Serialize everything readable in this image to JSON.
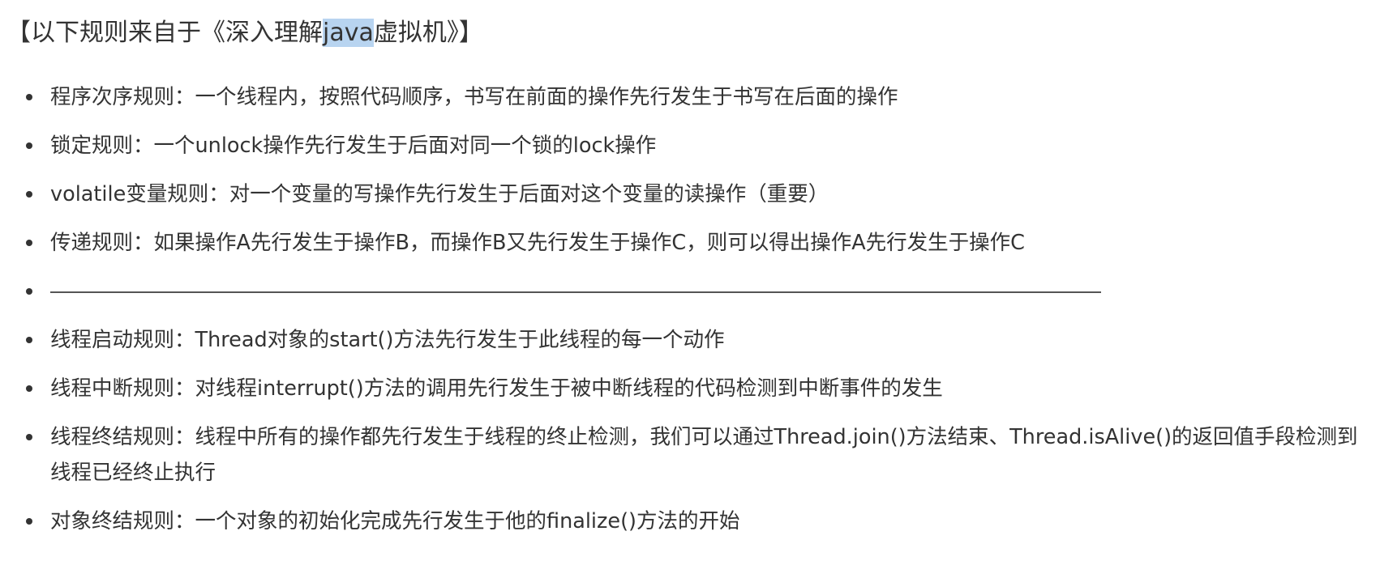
{
  "heading": {
    "prefix": "【以下规则来自于《深入理解",
    "highlight": "java",
    "suffix": "虚拟机》】"
  },
  "rules": [
    "程序次序规则：一个线程内，按照代码顺序，书写在前面的操作先行发生于书写在后面的操作",
    "锁定规则：一个unlock操作先行发生于后面对同一个锁的lock操作",
    "volatile变量规则：对一个变量的写操作先行发生于后面对这个变量的读操作（重要）",
    "传递规则：如果操作A先行发生于操作B，而操作B又先行发生于操作C，则可以得出操作A先行发生于操作C",
    "——————————————————————————————————————",
    "线程启动规则：Thread对象的start()方法先行发生于此线程的每一个动作",
    "线程中断规则：对线程interrupt()方法的调用先行发生于被中断线程的代码检测到中断事件的发生",
    "线程终结规则：线程中所有的操作都先行发生于线程的终止检测，我们可以通过Thread.join()方法结束、Thread.isAlive()的返回值手段检测到线程已经终止执行",
    "对象终结规则：一个对象的初始化完成先行发生于他的finalize()方法的开始"
  ]
}
